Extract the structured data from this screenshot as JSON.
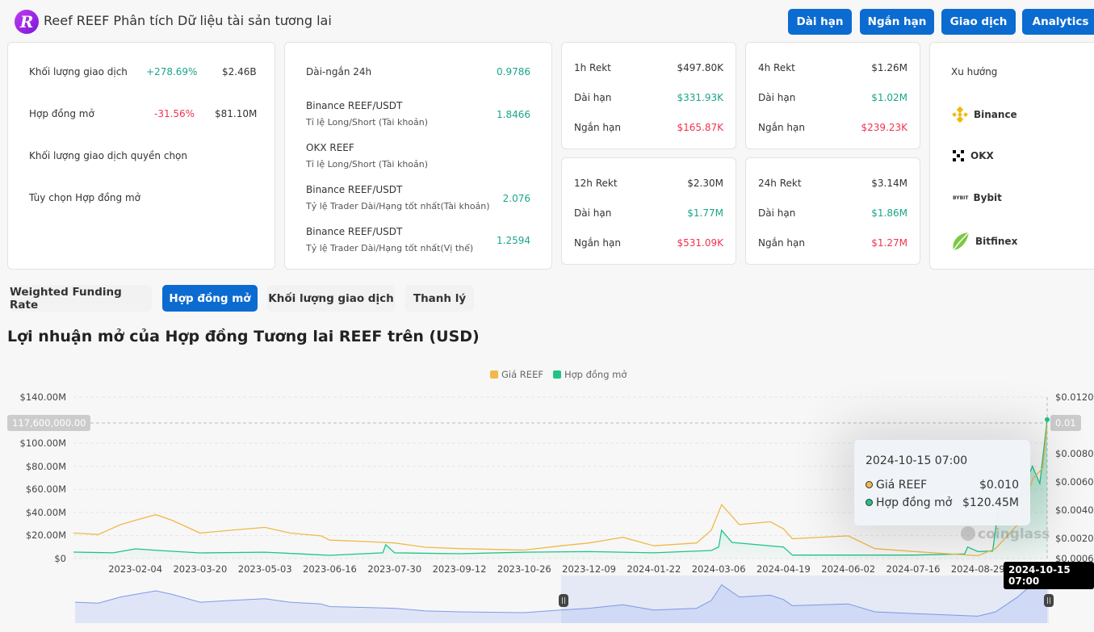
{
  "header": {
    "title": "Reef REEF Phân tích Dữ liệu tài sản tương lai",
    "logo_letter": "R",
    "buttons": [
      "Dài hạn",
      "Ngắn hạn",
      "Giao dịch",
      "Analytics"
    ]
  },
  "summary": {
    "rows": [
      {
        "label": "Khối lượng giao dịch",
        "change": "+278.69%",
        "value": "$2.46B"
      },
      {
        "label": "Hợp đồng mở",
        "change": "-31.56%",
        "value": "$81.10M"
      },
      {
        "label": "Khối lượng giao dịch quyền chọn"
      },
      {
        "label": "Tùy chọn Hợp đồng mở"
      }
    ]
  },
  "ratios": [
    {
      "title": "Dài-ngắn 24h",
      "sub": "",
      "value": "0.9786"
    },
    {
      "title": "Binance REEF/USDT",
      "sub": "Tỉ lệ Long/Short (Tài khoản)",
      "value": "1.8466"
    },
    {
      "title": "OKX REEF",
      "sub": "Tỉ lệ Long/Short (Tài khoản)",
      "value": ""
    },
    {
      "title": "Binance REEF/USDT",
      "sub": "Tỷ lệ Trader Dài/Hạng tốt nhất(Tài khoản)",
      "value": "2.076"
    },
    {
      "title": "Binance REEF/USDT",
      "sub": "Tỷ lệ Trader Dài/Hạng tốt nhất(Vị thế)",
      "value": "1.2594"
    }
  ],
  "rekt": [
    {
      "label": "1h Rekt",
      "total": "$497.80K",
      "long_label": "Dài hạn",
      "long": "$331.93K",
      "short_label": "Ngắn hạn",
      "short": "$165.87K"
    },
    {
      "label": "4h Rekt",
      "total": "$1.26M",
      "long_label": "Dài hạn",
      "long": "$1.02M",
      "short_label": "Ngắn hạn",
      "short": "$239.23K"
    },
    {
      "label": "12h Rekt",
      "total": "$2.30M",
      "long_label": "Dài hạn",
      "long": "$1.77M",
      "short_label": "Ngắn hạn",
      "short": "$531.09K"
    },
    {
      "label": "24h Rekt",
      "total": "$3.14M",
      "long_label": "Dài hạn",
      "long": "$1.86M",
      "short_label": "Ngắn hạn",
      "short": "$1.27M"
    }
  ],
  "trend": {
    "title": "Xu hướng",
    "exchanges": [
      {
        "name": "Binance",
        "icon": "binance-icon"
      },
      {
        "name": "OKX",
        "icon": "okx-icon"
      },
      {
        "name": "Bybit",
        "icon": "bybit-icon"
      },
      {
        "name": "Bitfinex",
        "icon": "bitfinex-icon"
      }
    ]
  },
  "tabs": [
    {
      "label": "Weighted Funding Rate",
      "active": false
    },
    {
      "label": "Hợp đồng mở",
      "active": true
    },
    {
      "label": "Khối lượng giao dịch",
      "active": false
    },
    {
      "label": "Thanh lý",
      "active": false
    }
  ],
  "chart_title": "Lợi nhuận mở của Hợp đồng Tương lai REEF trên (USD)",
  "chart_data": {
    "type": "line",
    "legend": [
      "Giá REEF",
      "Hợp đồng mở"
    ],
    "legend_placement": "top-center",
    "colors": {
      "price": "#f0b94a",
      "oi": "#1fc486",
      "navigator": "#7d9be8"
    },
    "x_range": [
      "2022-12-24",
      "2024-10-15"
    ],
    "x_ticks": [
      "2023-02-04",
      "2023-03-20",
      "2023-05-03",
      "2023-06-16",
      "2023-07-30",
      "2023-09-12",
      "2023-10-26",
      "2023-12-09",
      "2024-01-22",
      "2024-03-06",
      "2024-04-19",
      "2024-06-02",
      "2024-07-16",
      "2024-08-29"
    ],
    "y_left": {
      "ticks": [
        "$0",
        "$20.00M",
        "$40.00M",
        "$60.00M",
        "$80.00M",
        "$100.00M",
        "$140.00M"
      ],
      "range": [
        0,
        140
      ]
    },
    "y_right": {
      "ticks": [
        "$0.0006",
        "$0.0020",
        "$0.0040",
        "$0.0060",
        "$0.0080",
        "$0.0120"
      ],
      "range": [
        0.0006,
        0.012
      ]
    },
    "grid": true,
    "series": [
      {
        "name": "Giá REEF",
        "axis": "right",
        "points": [
          [
            "2022-12-24",
            0.0024
          ],
          [
            "2023-01-10",
            0.0023
          ],
          [
            "2023-01-25",
            0.003
          ],
          [
            "2023-02-04",
            0.0033
          ],
          [
            "2023-02-18",
            0.0037
          ],
          [
            "2023-03-01",
            0.0033
          ],
          [
            "2023-03-20",
            0.0024
          ],
          [
            "2023-04-10",
            0.0026
          ],
          [
            "2023-05-03",
            0.0028
          ],
          [
            "2023-05-20",
            0.0024
          ],
          [
            "2023-06-10",
            0.0022
          ],
          [
            "2023-06-16",
            0.0019
          ],
          [
            "2023-07-10",
            0.0018
          ],
          [
            "2023-07-30",
            0.0017
          ],
          [
            "2023-08-20",
            0.0014
          ],
          [
            "2023-09-12",
            0.0013
          ],
          [
            "2023-10-26",
            0.0012
          ],
          [
            "2023-11-20",
            0.0015
          ],
          [
            "2023-12-09",
            0.0017
          ],
          [
            "2024-01-01",
            0.0021
          ],
          [
            "2024-01-22",
            0.0015
          ],
          [
            "2024-02-20",
            0.0017
          ],
          [
            "2024-03-01",
            0.0026
          ],
          [
            "2024-03-08",
            0.0044
          ],
          [
            "2024-03-20",
            0.003
          ],
          [
            "2024-04-10",
            0.0032
          ],
          [
            "2024-04-19",
            0.0027
          ],
          [
            "2024-04-25",
            0.002
          ],
          [
            "2024-06-02",
            0.0022
          ],
          [
            "2024-06-20",
            0.0013
          ],
          [
            "2024-07-16",
            0.0011
          ],
          [
            "2024-08-29",
            0.0008
          ],
          [
            "2024-09-10",
            0.0013
          ],
          [
            "2024-09-25",
            0.003
          ],
          [
            "2024-10-05",
            0.0062
          ],
          [
            "2024-10-12",
            0.007
          ],
          [
            "2024-10-15",
            0.01
          ]
        ]
      },
      {
        "name": "Hợp đồng mở",
        "axis": "left",
        "points": [
          [
            "2022-12-24",
            5.6
          ],
          [
            "2023-01-20",
            5.0
          ],
          [
            "2023-02-04",
            8.4
          ],
          [
            "2023-02-20",
            7.0
          ],
          [
            "2023-03-20",
            4.9
          ],
          [
            "2023-05-03",
            5.5
          ],
          [
            "2023-06-16",
            2.8
          ],
          [
            "2023-07-22",
            5.0
          ],
          [
            "2023-07-24",
            12
          ],
          [
            "2023-07-30",
            5.0
          ],
          [
            "2023-09-12",
            4.2
          ],
          [
            "2023-10-26",
            5.5
          ],
          [
            "2023-12-09",
            6.0
          ],
          [
            "2024-01-22",
            5.0
          ],
          [
            "2024-03-01",
            7.0
          ],
          [
            "2024-03-06",
            10
          ],
          [
            "2024-03-08",
            24.5
          ],
          [
            "2024-03-15",
            14
          ],
          [
            "2024-04-19",
            10
          ],
          [
            "2024-04-25",
            3.0
          ],
          [
            "2024-06-02",
            3.0
          ],
          [
            "2024-07-16",
            3.0
          ],
          [
            "2024-08-20",
            4.0
          ],
          [
            "2024-08-22",
            10
          ],
          [
            "2024-08-29",
            6.0
          ],
          [
            "2024-09-08",
            6.5
          ],
          [
            "2024-09-12",
            45
          ],
          [
            "2024-09-25",
            50
          ],
          [
            "2024-10-05",
            80
          ],
          [
            "2024-10-10",
            65
          ],
          [
            "2024-10-15",
            120.45
          ]
        ]
      }
    ],
    "crosshair": {
      "left_label": "117,600,000.00",
      "right_label": "0.01",
      "x_label": "2024-10-15 07:00"
    },
    "tooltip": {
      "date": "2024-10-15 07:00",
      "rows": [
        {
          "label": "Giá REEF",
          "value": "$0.010"
        },
        {
          "label": "Hợp đồng mở",
          "value": "$120.45M"
        }
      ]
    },
    "watermark": "coinglass",
    "navigator_selection": [
      "2023-11-20",
      "2024-10-15"
    ]
  }
}
